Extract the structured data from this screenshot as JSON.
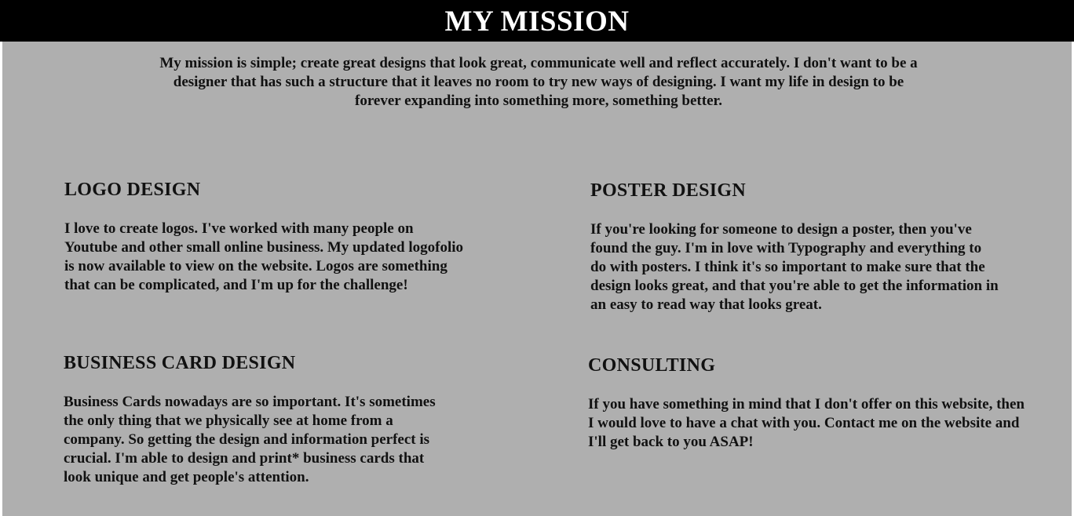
{
  "header": {
    "title": "MY MISSION"
  },
  "mission": {
    "text": "My mission is simple; create great designs that look great, communicate well and reflect accurately. I don't want to be a designer that has such a structure that it leaves no room to try new ways of designing. I want my life in design to be forever expanding into something more, something better."
  },
  "services": {
    "logo": {
      "title": "LOGO DESIGN",
      "text": "I love to create logos. I've worked with many people on Youtube and other small online business. My updated logofolio is now available to view on the website. Logos are something that can be complicated, and I'm up for the challenge!"
    },
    "poster": {
      "title": "POSTER DESIGN",
      "text": "If you're looking for someone to design a poster, then you've found the guy. I'm in love with Typography and everything to do with posters. I think it's so important to make sure that the design looks great, and that you're able to get the information in an easy to read way that looks great."
    },
    "business": {
      "title": "BUSINESS CARD DESIGN",
      "text": "Business Cards nowadays are so important. It's sometimes the only thing that we physically see at home from a company. So getting the design and information perfect is crucial. I'm able to design and print* business cards that look unique and get people's attention."
    },
    "consulting": {
      "title": "CONSULTING",
      "text": "If you have something in mind that I don't offer on this website, then I would love to have a chat with you. Contact me on the website and I'll get back to you ASAP!"
    }
  },
  "colors": {
    "header_bg": "#000000",
    "header_text": "#ffffff",
    "content_bg": "#afafaf",
    "body_text": "#111111"
  }
}
